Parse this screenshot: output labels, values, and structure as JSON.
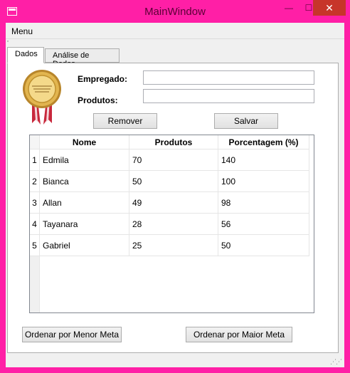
{
  "window": {
    "title": "MainWindow",
    "minimize": "—",
    "maximize": "☐",
    "close": "✕"
  },
  "menubar": {
    "menu_label": "Menu"
  },
  "tabs": [
    {
      "label": "Dados",
      "active": true
    },
    {
      "label": "Análise de Dados",
      "active": false
    }
  ],
  "form": {
    "employee_label": "Empregado:",
    "employee_value": "",
    "products_label": "Produtos:",
    "products_value": "",
    "remove_label": "Remover",
    "save_label": "Salvar"
  },
  "table": {
    "headers": [
      "Nome",
      "Produtos",
      "Porcentagem (%)"
    ],
    "rows": [
      {
        "index": "1",
        "nome": "Edmila",
        "produtos": "70",
        "porcentagem": "140"
      },
      {
        "index": "2",
        "nome": "Bianca",
        "produtos": "50",
        "porcentagem": "100"
      },
      {
        "index": "3",
        "nome": "Allan",
        "produtos": "49",
        "porcentagem": "98"
      },
      {
        "index": "4",
        "nome": "Tayanara",
        "produtos": "28",
        "porcentagem": "56"
      },
      {
        "index": "5",
        "nome": "Gabriel",
        "produtos": "25",
        "porcentagem": "50"
      }
    ]
  },
  "buttons": {
    "sort_lower_label": "Ordenar por Menor Meta",
    "sort_higher_label": "Ordenar por Maior Meta"
  },
  "colors": {
    "frame": "#ff1fa6",
    "close": "#c7352a"
  }
}
